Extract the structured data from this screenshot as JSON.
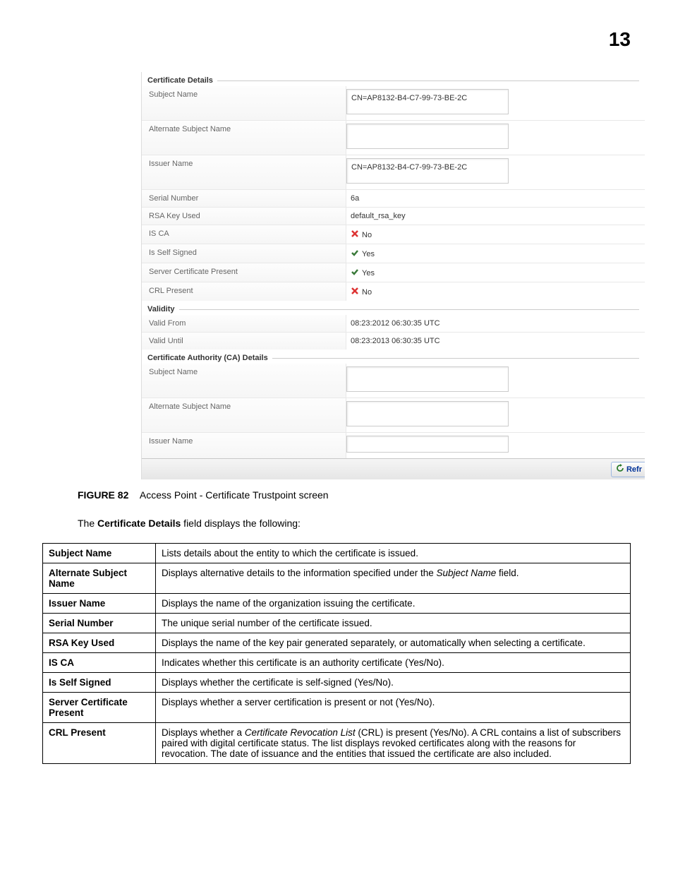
{
  "page_number": "13",
  "screenshot": {
    "section_cert_details": "Certificate Details",
    "section_validity": "Validity",
    "section_ca_details": "Certificate Authority (CA) Details",
    "labels": {
      "subject_name": "Subject Name",
      "alt_subject_name": "Alternate Subject Name",
      "issuer_name": "Issuer Name",
      "serial_number": "Serial Number",
      "rsa_key_used": "RSA Key Used",
      "is_ca": "IS CA",
      "is_self_signed": "Is Self Signed",
      "server_cert_present": "Server Certificate Present",
      "crl_present": "CRL Present",
      "valid_from": "Valid From",
      "valid_until": "Valid Until"
    },
    "values": {
      "subject_name": "CN=AP8132-B4-C7-99-73-BE-2C",
      "alt_subject_name": "",
      "issuer_name": "CN=AP8132-B4-C7-99-73-BE-2C",
      "serial_number": "6a",
      "rsa_key_used": "default_rsa_key",
      "is_ca": "No",
      "is_self_signed": "Yes",
      "server_cert_present": "Yes",
      "crl_present": "No",
      "valid_from": "08:23:2012 06:30:35 UTC",
      "valid_until": "08:23:2013 06:30:35 UTC",
      "ca_subject_name": "",
      "ca_alt_subject_name": "",
      "ca_issuer_name": ""
    },
    "refresh_label": "Refr"
  },
  "figure": {
    "label": "FIGURE 82",
    "caption": "Access Point - Certificate Trustpoint screen"
  },
  "intro_prefix": "The ",
  "intro_bold": "Certificate Details",
  "intro_suffix": " field displays the following:",
  "table_rows": [
    {
      "term": "Subject Name",
      "desc": "Lists details about the entity to which the certificate is issued."
    },
    {
      "term": "Alternate Subject Name",
      "desc_pre": "Displays alternative details to the information specified under the ",
      "desc_italic": "Subject Name",
      "desc_post": " field."
    },
    {
      "term": "Issuer Name",
      "desc": "Displays the name of the organization issuing the certificate."
    },
    {
      "term": "Serial Number",
      "desc": "The unique serial number of the certificate issued."
    },
    {
      "term": "RSA Key Used",
      "desc": "Displays the name of the key pair generated separately, or automatically when selecting a certificate."
    },
    {
      "term": "IS CA",
      "desc": "Indicates whether this certificate is an authority certificate (Yes/No)."
    },
    {
      "term": "Is Self Signed",
      "desc": "Displays whether the certificate is self-signed (Yes/No)."
    },
    {
      "term": "Server Certificate Present",
      "desc": "Displays whether a server certification is present or not (Yes/No)."
    },
    {
      "term": "CRL Present",
      "desc_pre": "Displays whether a ",
      "desc_italic": "Certificate Revocation List",
      "desc_post": " (CRL) is present (Yes/No). A CRL contains a list of subscribers paired with digital certificate status. The list displays revoked certificates along with the reasons for revocation. The date of issuance and the entities that issued the certificate are also included."
    }
  ]
}
